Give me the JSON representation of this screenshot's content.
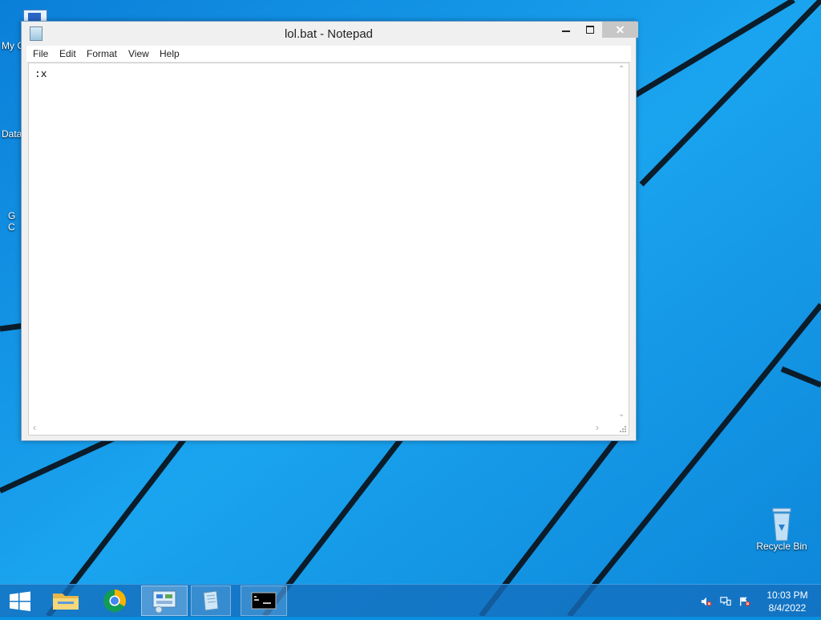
{
  "desktop": {
    "icons": [
      {
        "label": "My C"
      },
      {
        "label": "Data"
      },
      {
        "label": "G"
      },
      {
        "label": "C"
      },
      {
        "label": "Recycle Bin"
      }
    ]
  },
  "notepad": {
    "title": "lol.bat - Notepad",
    "menu": [
      "File",
      "Edit",
      "Format",
      "View",
      "Help"
    ],
    "content": ":x"
  },
  "taskbar": {
    "clock_time": "10:03 PM",
    "clock_date": "8/4/2022"
  },
  "icons": {
    "start": "windows-logo-icon",
    "explorer": "folder-icon",
    "chrome": "chrome-icon",
    "tray": [
      "speaker-muted-icon",
      "network-icon",
      "action-center-icon"
    ]
  },
  "colors": {
    "wallpaper": "#0a8fe0",
    "window_border": "#6f9ec9",
    "close_button": "#c7c7c7"
  }
}
